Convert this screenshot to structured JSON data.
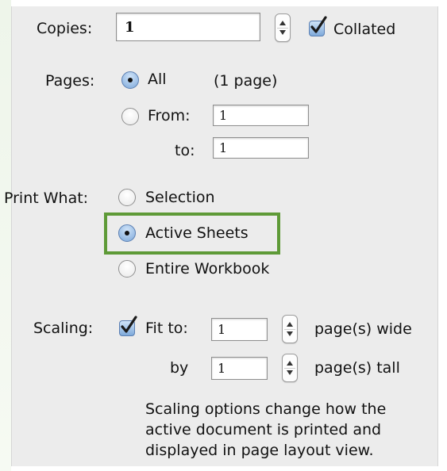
{
  "copies": {
    "label": "Copies:",
    "value": "1",
    "collated_label": "Collated",
    "collated_checked": true
  },
  "pages": {
    "label": "Pages:",
    "all_label": "All",
    "all_count": "(1 page)",
    "from_label": "From:",
    "from_value": "1",
    "to_label": "to:",
    "to_value": "1",
    "selected": "All"
  },
  "print_what": {
    "label": "Print What:",
    "options": [
      "Selection",
      "Active Sheets",
      "Entire Workbook"
    ],
    "selected": "Active Sheets"
  },
  "scaling": {
    "label": "Scaling:",
    "fit_to_label": "Fit to:",
    "fit_to_checked": true,
    "wide_value": "1",
    "wide_label": "page(s) wide",
    "by_label": "by",
    "tall_value": "1",
    "tall_label": "page(s) tall",
    "note": "Scaling options change how the\nactive document is printed and\ndisplayed in page layout view."
  },
  "colors": {
    "highlight_border": "#5e9a37",
    "radio_selected": "#7ea9da",
    "panel_bg": "#ececec"
  }
}
